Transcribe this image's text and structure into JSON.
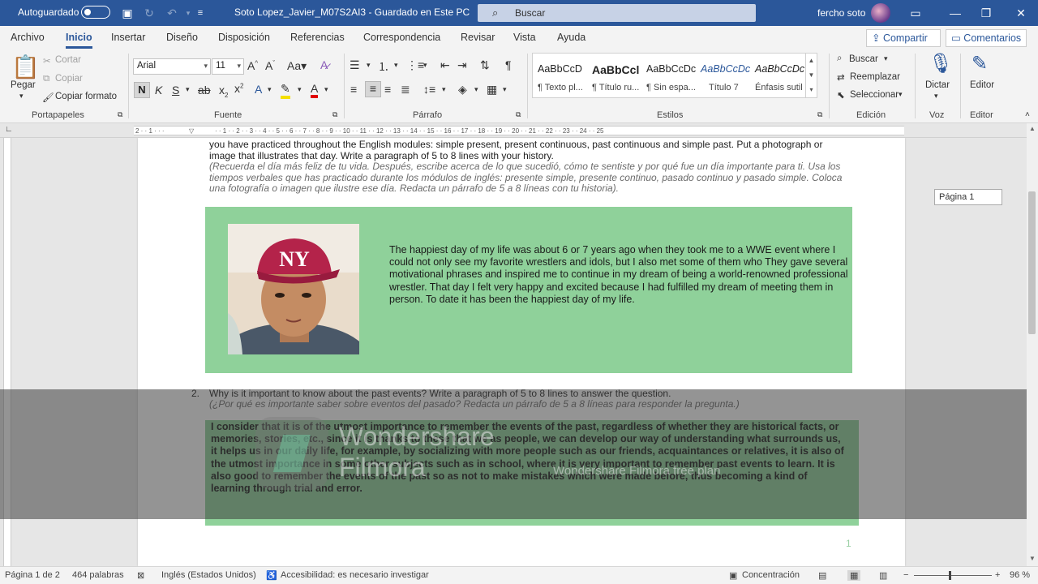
{
  "titlebar": {
    "autosave_label": "Autoguardado",
    "doc_title": "Soto Lopez_Javier_M07S2AI3 - Guardado en Este PC",
    "search_placeholder": "Buscar",
    "user_name": "fercho soto"
  },
  "menu": {
    "tabs": [
      "Archivo",
      "Inicio",
      "Insertar",
      "Diseño",
      "Disposición",
      "Referencias",
      "Correspondencia",
      "Revisar",
      "Vista",
      "Ayuda"
    ],
    "share": "Compartir",
    "comments": "Comentarios"
  },
  "ribbon": {
    "clipboard": {
      "paste": "Pegar",
      "cut": "Cortar",
      "copy": "Copiar",
      "format_painter": "Copiar formato",
      "label": "Portapapeles"
    },
    "font": {
      "name": "Arial",
      "size": "11",
      "label": "Fuente"
    },
    "paragraph": {
      "label": "Párrafo"
    },
    "styles": {
      "label": "Estilos",
      "items": [
        {
          "sample": "AaBbCcD",
          "name": "¶ Texto pl..."
        },
        {
          "sample": "AaBbCcl",
          "name": "¶ Título ru..."
        },
        {
          "sample": "AaBbCcDc",
          "name": "¶ Sin espa..."
        },
        {
          "sample": "AaBbCcDc",
          "name": "Título 7"
        },
        {
          "sample": "AaBbCcDc",
          "name": "Énfasis sutil"
        }
      ]
    },
    "editing": {
      "find": "Buscar",
      "replace": "Reemplazar",
      "select": "Seleccionar",
      "label": "Edición"
    },
    "voice": {
      "dictate": "Dictar",
      "label": "Voz"
    },
    "editor": {
      "editor": "Editor",
      "label": "Editor"
    }
  },
  "document": {
    "q1_en_partial": "you have practiced throughout the English modules: simple present, present continuous, past continuous and simple past.  Put a  photograph or image that illustrates that day. Write a paragraph of 5 to 8 lines with your history.",
    "q1_es": "(Recuerda el día más feliz de tu vida. Después, escribe acerca de lo que sucedió, cómo te sentiste y por qué fue un día importante para ti. Usa los tiempos verbales que has practicado durante los módulos de inglés: presente simple, presente continuo, pasado continuo y pasado simple. Coloca una fotografía o imagen que ilustre ese día. Redacta un párrafo de 5 a 8 líneas con tu historia).",
    "answer1": "The happiest day of my life was about 6 or 7 years ago when they took me to a WWE event where I could not only see my favorite wrestlers and idols, but I also met some of them who They gave several motivational phrases and inspired me to continue in my dream of being a world-renowned professional wrestler. That day I felt very happy and excited because I had fulfilled my dream of meeting them in person. To date it has been the happiest day of my life.",
    "q2_number": "2.",
    "q2_en": "Why is it important to know about the past events? Write a paragraph of 5 to 8 lines to answer the question.",
    "q2_es": "(¿Por qué es importante saber sobre eventos  del pasado? Redacta un párrafo de 5 a 8 líneas para responder la pregunta.)",
    "answer2": "I consider that it is of the utmost importance to remember the events of the past, regardless of whether they are historical facts, or memories, stories, etc., since it is thanks to these that we as people, we can develop our way of understanding what surrounds us, it helps us in our daily life, for example, by socializing with more people such as our friends, acquaintances or relatives, it is also of the utmost importance in some other subjects such as in school, where it is very important to remember past events to learn. It is also good to remember the events of the past so as not to make mistakes which were made before, thus becoming a kind of learning through trial and error.",
    "page_number": "1",
    "page_tooltip": "Página 1"
  },
  "watermark": {
    "title": "Wondershare",
    "subtitle": "Filmora",
    "free_plan": "Wondershare Filmora free plan"
  },
  "statusbar": {
    "page": "Página 1 de 2",
    "words": "464 palabras",
    "language": "Inglés (Estados Unidos)",
    "accessibility": "Accesibilidad: es necesario investigar",
    "focus": "Concentración",
    "zoom": "96 %"
  },
  "colors": {
    "brand": "#2b579a",
    "answer_box": "#8fd19a"
  }
}
